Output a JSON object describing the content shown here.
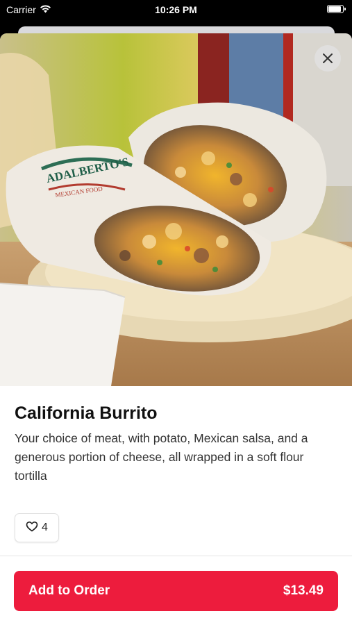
{
  "status_bar": {
    "carrier": "Carrier",
    "time": "10:26 PM",
    "battery_level": 1.0
  },
  "item": {
    "name": "California Burrito",
    "description": "Your choice of meat, with potato, Mexican salsa, and a generous portion of cheese, all wrapped in a soft flour tortilla",
    "likes": "4",
    "photo_wrapper_text": "ADALBERTO'S",
    "photo_wrapper_subtext": "MEXICAN FOOD"
  },
  "order_button": {
    "label": "Add to Order",
    "price": "$13.49"
  },
  "colors": {
    "accent": "#ed1c3d",
    "background": "#ffffff"
  },
  "icons": {
    "close": "close-icon",
    "like": "heart-icon",
    "wifi": "wifi-icon",
    "battery": "battery-icon"
  }
}
